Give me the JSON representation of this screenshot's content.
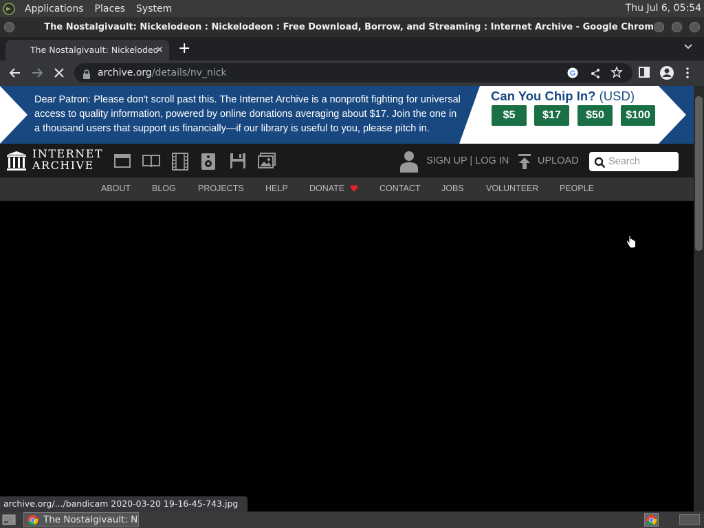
{
  "panel": {
    "menus": [
      "Applications",
      "Places",
      "System"
    ],
    "clock": "Thu Jul  6, 05:54"
  },
  "window": {
    "title": "The Nostalgivault: Nickelodeon : Nickelodeon : Free Download, Borrow, and Streaming : Internet Archive - Google Chrome"
  },
  "tab": {
    "title": "The Nostalgivault: Nickelodeo",
    "close": "✕",
    "new_tab": "+"
  },
  "omnibox": {
    "domain": "archive.org",
    "path": "/details/nv_nick"
  },
  "banner": {
    "message": "Dear Patron: Please don't scroll past this. The Internet Archive is a nonprofit fighting for universal access to quality information, powered by online donations averaging about $17. Join the one in a thousand users that support us financially—if our library is useful to you, please pitch in.",
    "chip_prompt": "Can You Chip In?",
    "currency": "(USD)",
    "amounts": [
      "$5",
      "$17",
      "$50",
      "$100"
    ]
  },
  "header": {
    "logo_line1": "INTERNET",
    "logo_line2": "ARCHIVE",
    "signup": "SIGN UP | LOG IN",
    "upload": "UPLOAD",
    "search_placeholder": "Search"
  },
  "nav": [
    "ABOUT",
    "BLOG",
    "PROJECTS",
    "HELP",
    "DONATE",
    "CONTACT",
    "JOBS",
    "VOLUNTEER",
    "PEOPLE"
  ],
  "status_url": "archive.org/.../bandicam 2020-03-20 19-16-45-743.jpg",
  "taskbar": {
    "task_title": "The Nostalgivault: N..."
  },
  "colors": {
    "banner_blue": "#194880",
    "donate_green": "#1b6f45",
    "donate_heart": "#d9262f"
  }
}
